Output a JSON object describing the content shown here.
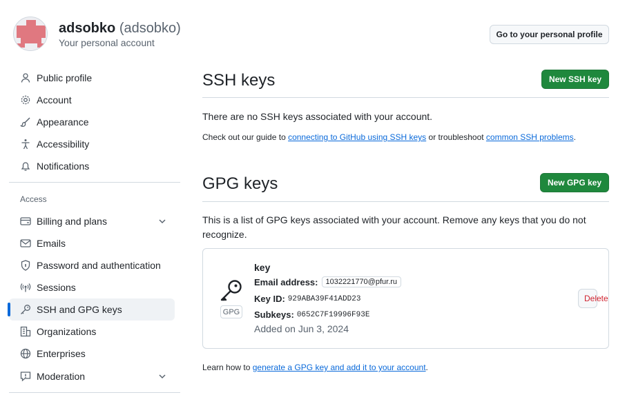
{
  "header": {
    "display_name": "adsobko",
    "login": "(adsobko)",
    "subtitle": "Your personal account",
    "profile_button": "Go to your personal profile"
  },
  "sidebar": {
    "items": [
      {
        "label": "Public profile",
        "icon": "person-icon"
      },
      {
        "label": "Account",
        "icon": "gear-icon"
      },
      {
        "label": "Appearance",
        "icon": "paintbrush-icon"
      },
      {
        "label": "Accessibility",
        "icon": "accessibility-icon"
      },
      {
        "label": "Notifications",
        "icon": "bell-icon"
      }
    ],
    "access_heading": "Access",
    "access_items": [
      {
        "label": "Billing and plans",
        "icon": "credit-card-icon",
        "expandable": true
      },
      {
        "label": "Emails",
        "icon": "mail-icon"
      },
      {
        "label": "Password and authentication",
        "icon": "shield-lock-icon"
      },
      {
        "label": "Sessions",
        "icon": "broadcast-icon"
      },
      {
        "label": "SSH and GPG keys",
        "icon": "key-icon",
        "active": true
      },
      {
        "label": "Organizations",
        "icon": "organization-icon"
      },
      {
        "label": "Enterprises",
        "icon": "globe-icon"
      },
      {
        "label": "Moderation",
        "icon": "report-icon",
        "expandable": true
      }
    ]
  },
  "ssh": {
    "title": "SSH keys",
    "new_button": "New SSH key",
    "empty_text": "There are no SSH keys associated with your account.",
    "guide_prefix": "Check out our guide to ",
    "guide_link": "connecting to GitHub using SSH keys",
    "guide_mid": " or troubleshoot ",
    "problems_link": "common SSH problems",
    "guide_suffix": "."
  },
  "gpg": {
    "title": "GPG keys",
    "new_button": "New GPG key",
    "description": "This is a list of GPG keys associated with your account. Remove any keys that you do not recognize.",
    "key": {
      "badge": "GPG",
      "name": "key",
      "email_label": "Email address:",
      "email": "1032221770@pfur.ru",
      "key_id_label": "Key ID:",
      "key_id": "929ABA39F41ADD23",
      "subkeys_label": "Subkeys:",
      "subkeys": "0652C7F19996F93E",
      "added": "Added on Jun 3, 2024",
      "delete_button": "Delete"
    },
    "learn_prefix": "Learn how to ",
    "learn_link": "generate a GPG key and add it to your account",
    "learn_suffix": "."
  },
  "colors": {
    "primary_green": "#1f883d",
    "link_blue": "#0969da",
    "danger_red": "#cf222e",
    "avatar_red": "#e07880"
  }
}
